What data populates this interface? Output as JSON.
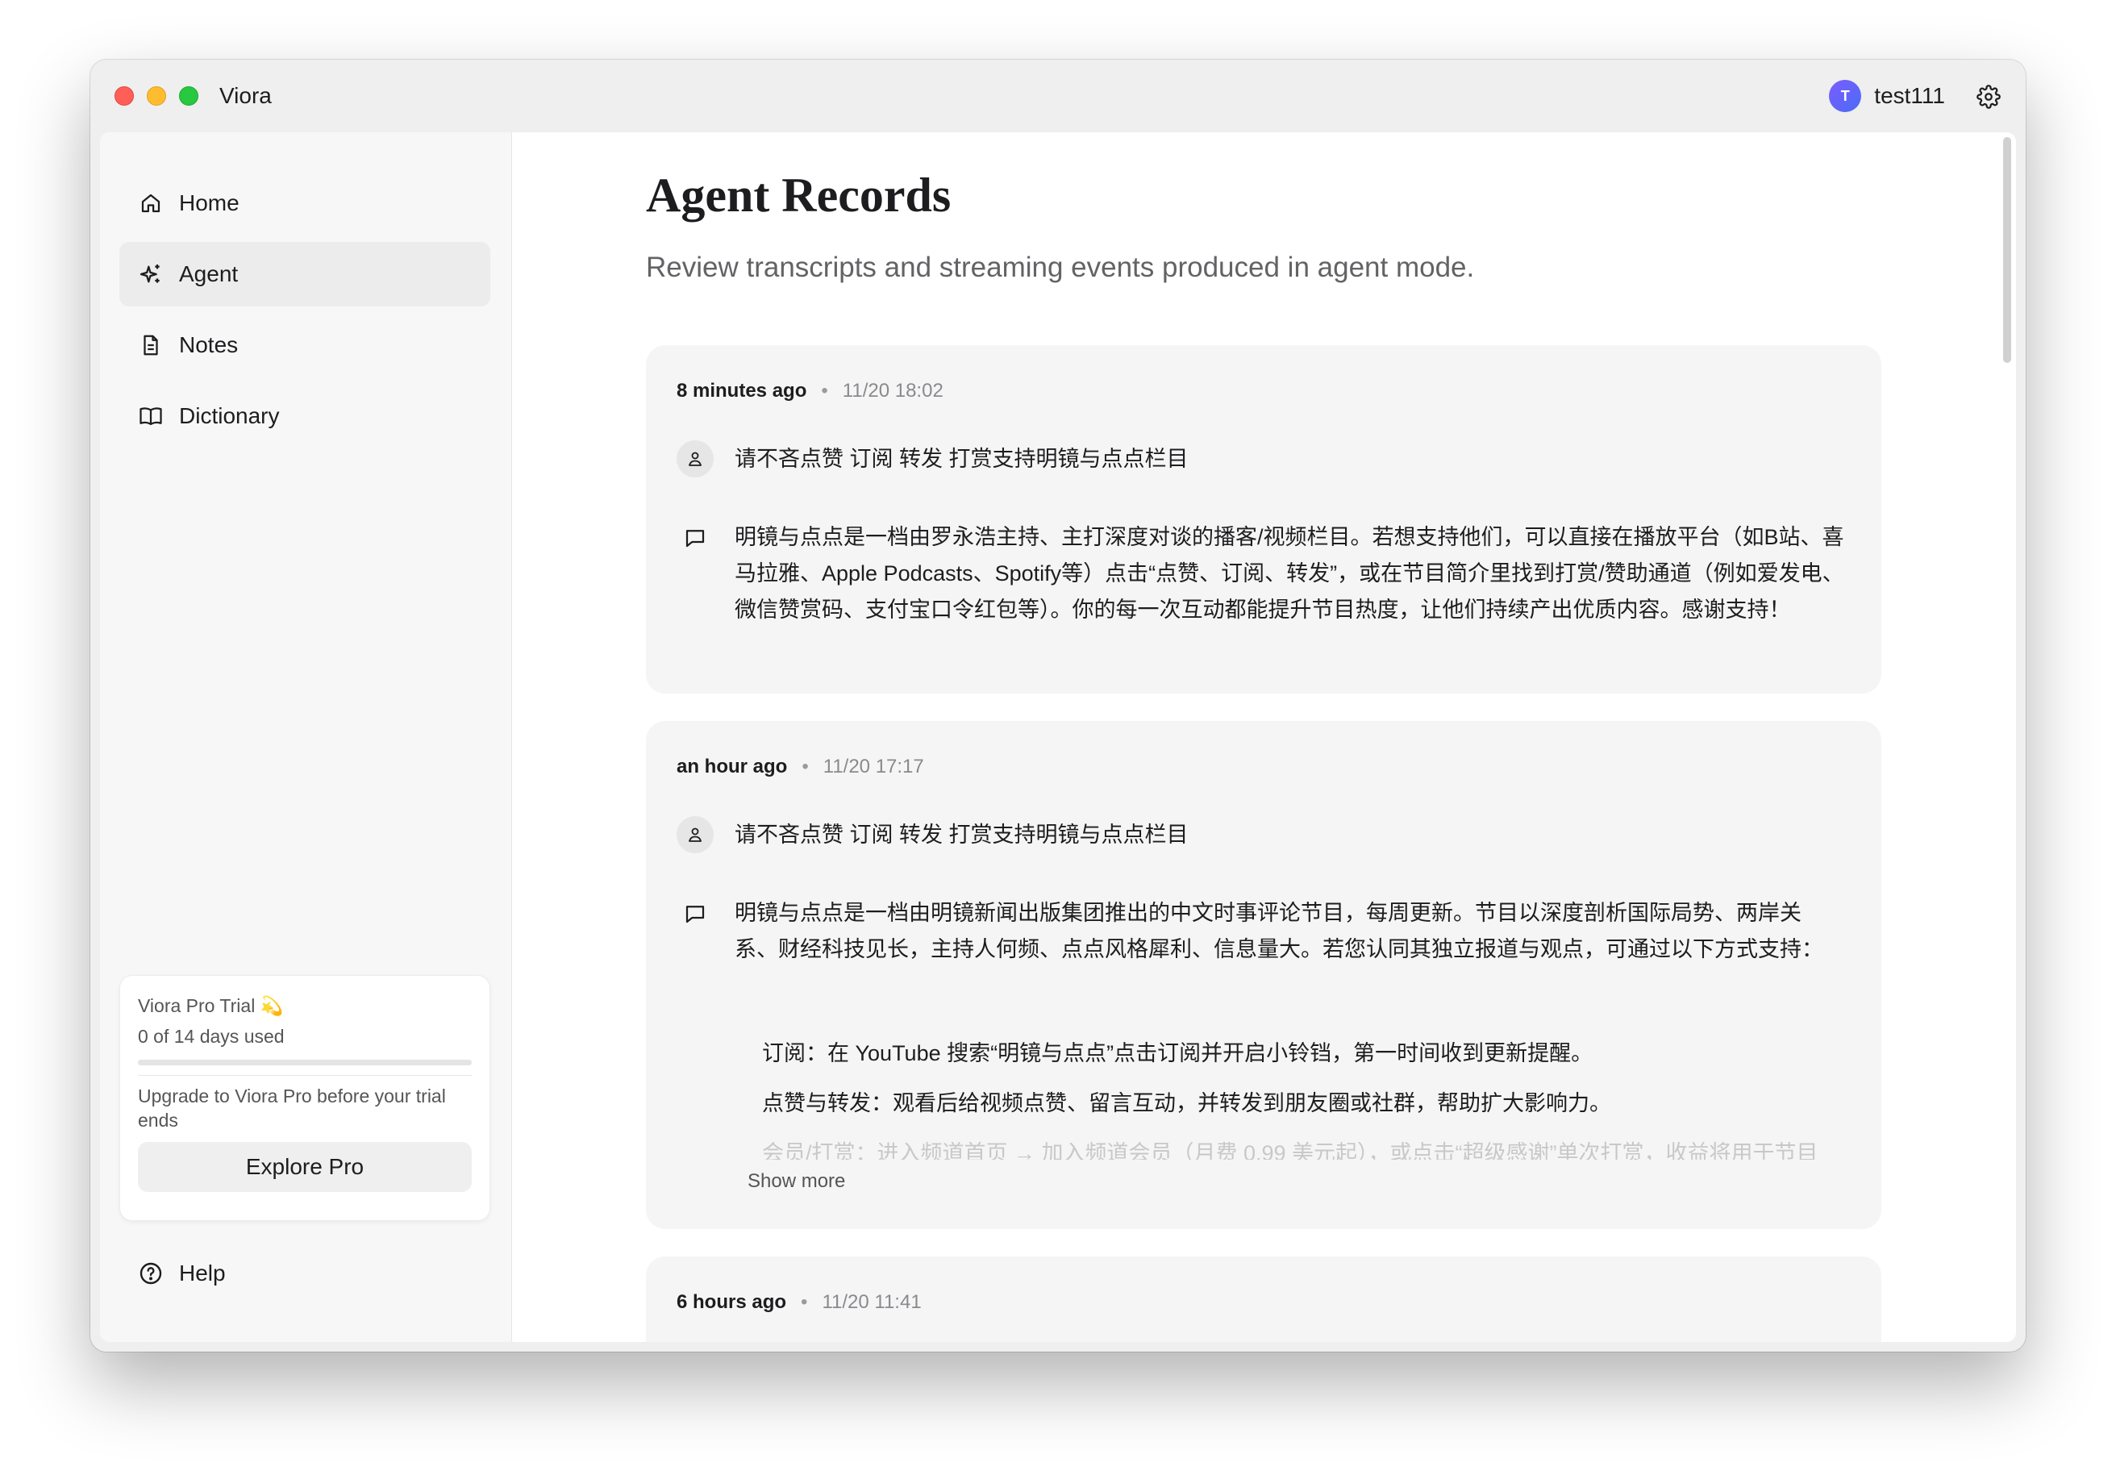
{
  "window": {
    "app_title": "Viora",
    "user": {
      "initial": "T",
      "name": "test111"
    }
  },
  "sidebar": {
    "items": [
      {
        "label": "Home",
        "icon": "home-icon"
      },
      {
        "label": "Agent",
        "icon": "sparkles-icon",
        "active": true
      },
      {
        "label": "Notes",
        "icon": "document-icon"
      },
      {
        "label": "Dictionary",
        "icon": "book-icon"
      }
    ],
    "trial": {
      "title": "Viora Pro Trial 💫",
      "used": "0 of 14 days used",
      "progress_fraction": 0,
      "message": "Upgrade to Viora Pro before your trial ends",
      "button_label": "Explore Pro"
    },
    "help_label": "Help"
  },
  "main": {
    "title": "Agent Records",
    "subtitle": "Review transcripts and streaming events produced in agent mode.",
    "records": [
      {
        "relative_time": "8 minutes ago",
        "timestamp": "11/20 18:02",
        "prompt": "请不吝点赞 订阅 转发 打赏支持明镜与点点栏目",
        "response": "明镜与点点是一档由罗永浩主持、主打深度对谈的播客/视频栏目。若想支持他们，可以直接在播放平台（如B站、喜马拉雅、Apple Podcasts、Spotify等）点击“点赞、订阅、转发”，或在节目简介里找到打赏/赞助通道（例如爱发电、微信赞赏码、支付宝口令红包等）。你的每一次互动都能提升节目热度，让他们持续产出优质内容。感谢支持！"
      },
      {
        "relative_time": "an hour ago",
        "timestamp": "11/20 17:17",
        "prompt": "请不吝点赞 订阅 转发 打赏支持明镜与点点栏目",
        "response": "明镜与点点是一档由明镜新闻出版集团推出的中文时事评论节目，每周更新。节目以深度剖析国际局势、两岸关系、财经科技见长，主持人何频、点点风格犀利、信息量大。若您认同其独立报道与观点，可通过以下方式支持：",
        "bullets": [
          "订阅：在 YouTube 搜索“明镜与点点”点击订阅并开启小铃铛，第一时间收到更新提醒。",
          "点赞与转发：观看后给视频点赞、留言互动，并转发到朋友圈或社群，帮助扩大影响力。",
          "会员/打赏：进入频道首页 → 加入频道会员（月费 0.99 美元起），或点击“超级感谢”单次打赏，收益将用于节目"
        ],
        "show_more": "Show more"
      },
      {
        "relative_time": "6 hours ago",
        "timestamp": "11/20 11:41"
      }
    ]
  },
  "colors": {
    "accent": "#6b5cf6",
    "card_bg": "#f5f5f5",
    "sidebar_bg": "#f7f7f7"
  }
}
